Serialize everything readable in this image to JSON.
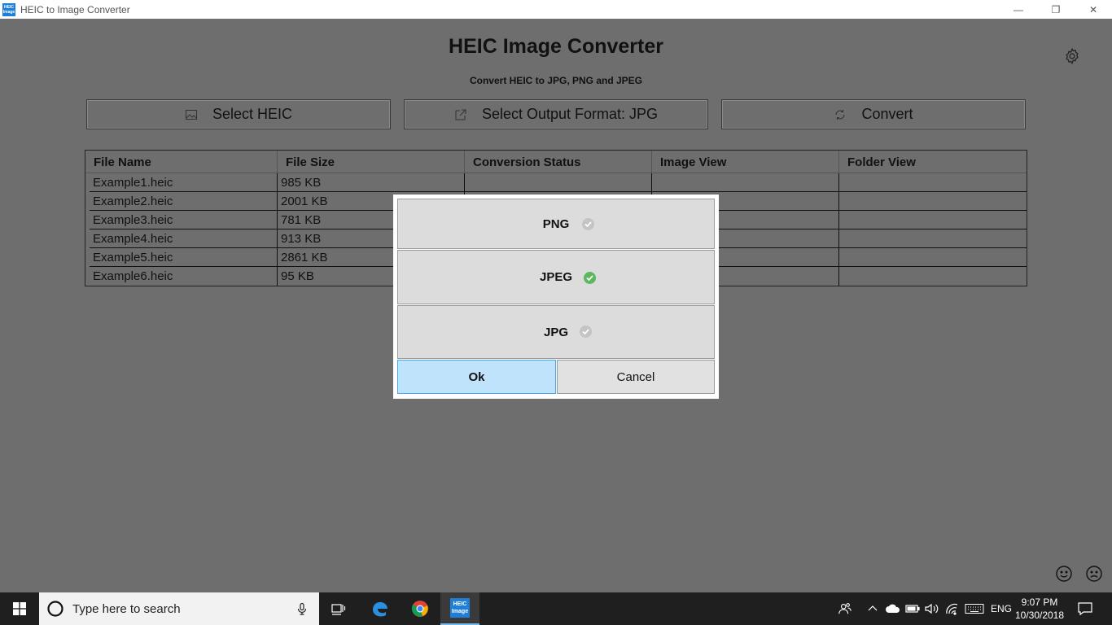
{
  "window": {
    "app_icon_text": "HEIC Image",
    "title": "HEIC to Image Converter",
    "minimize_glyph": "—",
    "maximize_glyph": "❐",
    "close_glyph": "✕"
  },
  "header": {
    "title": "HEIC Image Converter",
    "subtitle": "Convert HEIC to JPG, PNG and JPEG"
  },
  "toolbar": {
    "select_heic_label": "Select HEIC",
    "select_format_label": "Select Output Format: JPG",
    "convert_label": "Convert"
  },
  "table": {
    "columns": [
      "File Name",
      "File Size",
      "Conversion Status",
      "Image View",
      "Folder View"
    ],
    "rows": [
      {
        "name": "Example1.heic",
        "size": "985 KB"
      },
      {
        "name": "Example2.heic",
        "size": "2001 KB"
      },
      {
        "name": "Example3.heic",
        "size": "781 KB"
      },
      {
        "name": "Example4.heic",
        "size": "913 KB"
      },
      {
        "name": "Example5.heic",
        "size": "2861 KB"
      },
      {
        "name": "Example6.heic",
        "size": "95 KB"
      }
    ]
  },
  "dialog": {
    "options": [
      {
        "label": "PNG",
        "selected": false
      },
      {
        "label": "JPEG",
        "selected": true
      },
      {
        "label": "JPG",
        "selected": false
      }
    ],
    "ok_label": "Ok",
    "cancel_label": "Cancel"
  },
  "taskbar": {
    "search_placeholder": "Type here to search",
    "heic_icon_text": "HEIC Image",
    "language": "ENG",
    "time": "9:07 PM",
    "date": "10/30/2018"
  },
  "colors": {
    "background": "#6e6e6e",
    "selected_check": "#5cb85c",
    "unselected_check": "#c4c4c4",
    "ok_button": "#bfe3fb",
    "taskbar": "#1f1f1f"
  }
}
